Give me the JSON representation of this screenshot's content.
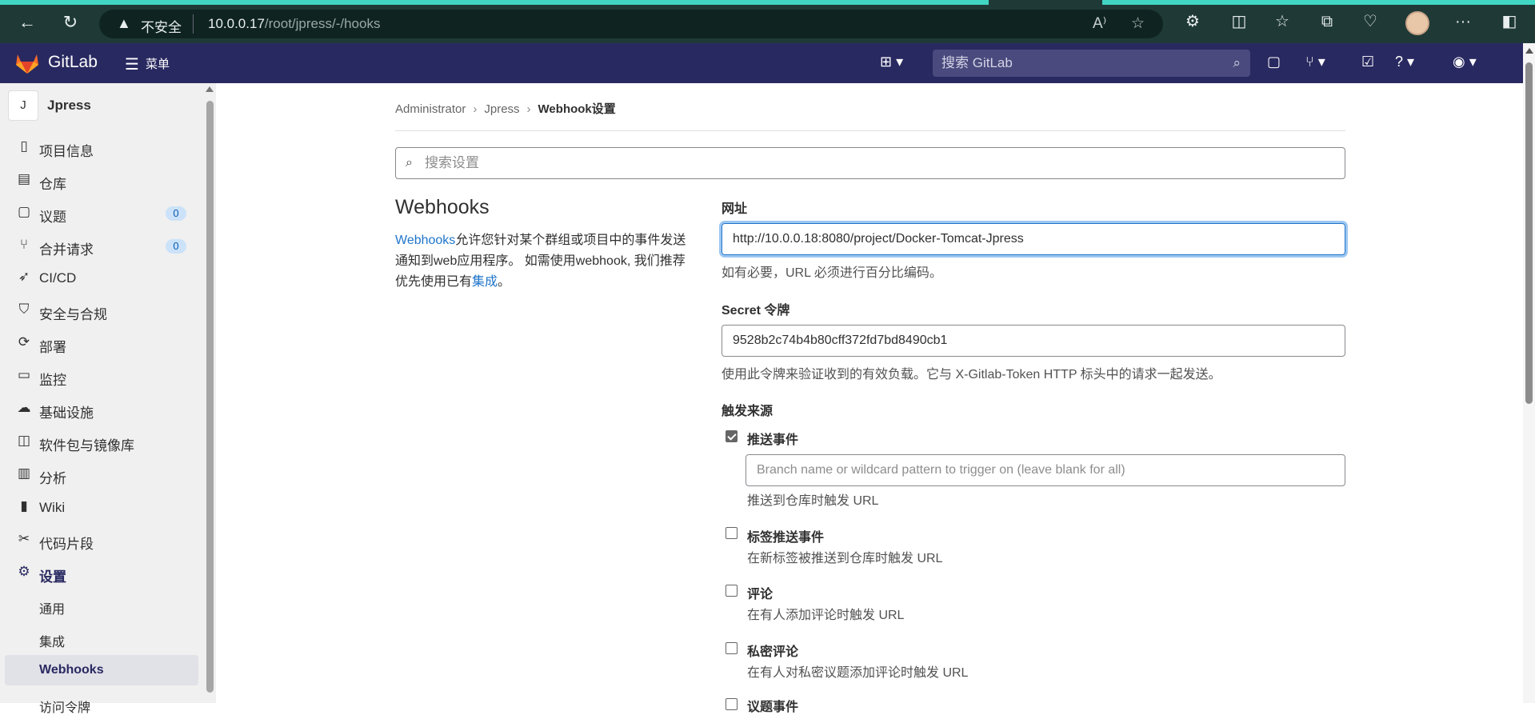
{
  "browser": {
    "insecure_label": "不安全",
    "url_host": "10.0.0.17",
    "url_path": "/root/jpress/-/hooks",
    "icons": [
      "back-icon",
      "refresh-icon",
      "warning-icon",
      "read-aloud-icon",
      "favorite-star-icon",
      "extensions-icon",
      "split-screen-icon",
      "favorites-icon",
      "collections-icon",
      "performance-icon",
      "profile-avatar",
      "more-icon",
      "sidebar-icon"
    ]
  },
  "header": {
    "brand": "GitLab",
    "menu_label": "菜单",
    "search_placeholder": "搜索 GitLab",
    "colors": {
      "background": "#292961",
      "logo": "#fc6d26"
    }
  },
  "sidebar": {
    "project_initial": "J",
    "project_name": "Jpress",
    "items": [
      {
        "label": "项目信息",
        "icon": "project-info-icon"
      },
      {
        "label": "仓库",
        "icon": "repository-icon"
      },
      {
        "label": "议题",
        "icon": "issues-icon",
        "count": "0"
      },
      {
        "label": "合并请求",
        "icon": "merge-request-icon",
        "count": "0"
      },
      {
        "label": "CI/CD",
        "icon": "rocket-icon"
      },
      {
        "label": "安全与合规",
        "icon": "shield-icon"
      },
      {
        "label": "部署",
        "icon": "deploy-icon"
      },
      {
        "label": "监控",
        "icon": "monitor-icon"
      },
      {
        "label": "基础设施",
        "icon": "cloud-icon"
      },
      {
        "label": "软件包与镜像库",
        "icon": "package-icon"
      },
      {
        "label": "分析",
        "icon": "chart-icon"
      },
      {
        "label": "Wiki",
        "icon": "book-icon"
      },
      {
        "label": "代码片段",
        "icon": "scissors-icon"
      },
      {
        "label": "设置",
        "icon": "gear-icon"
      }
    ],
    "sub_items": [
      "通用",
      "集成",
      "Webhooks",
      "访问令牌"
    ]
  },
  "breadcrumb": [
    "Administrator",
    "Jpress",
    "Webhook设置"
  ],
  "settings_search_placeholder": "搜索设置",
  "section": {
    "title": "Webhooks",
    "desc_link": "Webhooks",
    "desc_text": "允许您针对某个群组或项目中的事件发送通知到web应用程序。 如需使用webhook, 我们推荐优先使用已有",
    "desc_link2": "集成",
    "desc_end": "。"
  },
  "form": {
    "url_label": "网址",
    "url_value": "http://10.0.0.18:8080/project/Docker-Tomcat-Jpress",
    "url_help": "如有必要，URL 必须进行百分比编码。",
    "secret_label": "Secret 令牌",
    "secret_value": "9528b2c74b4b80cff372fd7bd8490cb1",
    "secret_help": "使用此令牌来验证收到的有效负载。它与 X-Gitlab-Token HTTP 标头中的请求一起发送。",
    "trigger_label": "触发来源",
    "branch_placeholder": "Branch name or wildcard pattern to trigger on (leave blank for all)",
    "triggers": [
      {
        "label": "推送事件",
        "help": "推送到仓库时触发 URL",
        "checked": true
      },
      {
        "label": "标签推送事件",
        "help": "在新标签被推送到仓库时触发 URL",
        "checked": false
      },
      {
        "label": "评论",
        "help": "在有人添加评论时触发 URL",
        "checked": false
      },
      {
        "label": "私密评论",
        "help": "在有人对私密议题添加评论时触发 URL",
        "checked": false
      },
      {
        "label": "议题事件",
        "help": "",
        "checked": false
      }
    ]
  }
}
